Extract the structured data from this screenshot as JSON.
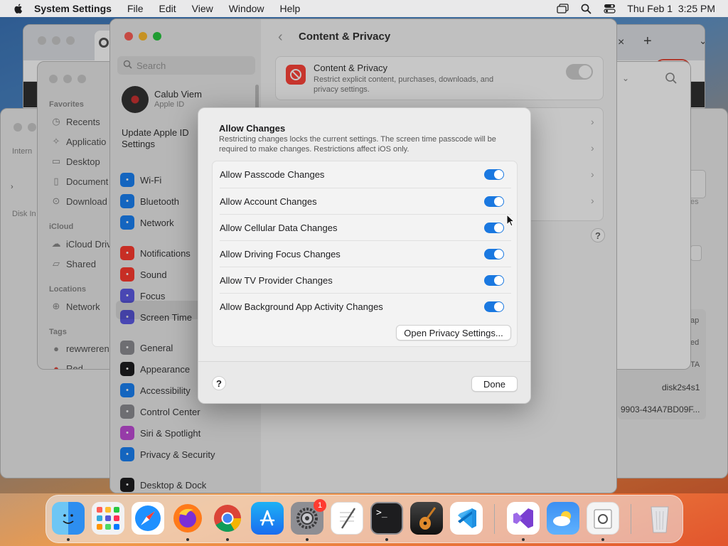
{
  "menubar": {
    "app": "System Settings",
    "menus": [
      "File",
      "Edit",
      "View",
      "Window",
      "Help"
    ],
    "clock": "Thu Feb 1  3:25 PM"
  },
  "finder": {
    "favorites_header": "Favorites",
    "favorites": [
      "Recents",
      "Applicatio",
      "Desktop",
      "Document",
      "Download"
    ],
    "icloud_header": "iCloud",
    "icloud": [
      "iCloud Driv",
      "Shared"
    ],
    "locations_header": "Locations",
    "locations": [
      "Network"
    ],
    "tags_header": "Tags",
    "tags": [
      "rewwreren",
      "Red"
    ]
  },
  "disk_utility": {
    "side_labels": [
      "Intern",
      "Disk In"
    ],
    "right_values": [
      "ap",
      "ed",
      "TA",
      "disk2s4s1",
      "9903-434A7BD09F..."
    ],
    "hint": "es"
  },
  "settings": {
    "search_placeholder": "Search",
    "user_name": "Calub Viem",
    "user_sub": "Apple ID",
    "update_label": "Update Apple ID Settings",
    "sidebar": [
      {
        "label": "Wi-Fi",
        "icon": "wifi-icon",
        "color": "#1a82f5"
      },
      {
        "label": "Bluetooth",
        "icon": "bluetooth-icon",
        "color": "#1a82f5"
      },
      {
        "label": "Network",
        "icon": "globe-icon",
        "color": "#1a82f5"
      },
      {
        "label": "Notifications",
        "icon": "bell-icon",
        "color": "#ff3b30"
      },
      {
        "label": "Sound",
        "icon": "speaker-icon",
        "color": "#ff3b30"
      },
      {
        "label": "Focus",
        "icon": "moon-icon",
        "color": "#5e5ce6"
      },
      {
        "label": "Screen Time",
        "icon": "hourglass-icon",
        "color": "#5e5ce6"
      },
      {
        "label": "General",
        "icon": "gear-icon",
        "color": "#8e8e93"
      },
      {
        "label": "Appearance",
        "icon": "appearance-icon",
        "color": "#1d1d1f"
      },
      {
        "label": "Accessibility",
        "icon": "accessibility-icon",
        "color": "#1a82f5"
      },
      {
        "label": "Control Center",
        "icon": "control-center-icon",
        "color": "#8e8e93"
      },
      {
        "label": "Siri & Spotlight",
        "icon": "siri-icon",
        "color": "#c04cd8"
      },
      {
        "label": "Privacy & Security",
        "icon": "hand-icon",
        "color": "#1a82f5"
      },
      {
        "label": "Desktop & Dock",
        "icon": "dock-icon",
        "color": "#1d1d1f"
      }
    ],
    "page_title": "Content & Privacy",
    "cp_title": "Content & Privacy",
    "cp_desc": "Restrict explicit content, purchases, downloads, and privacy settings."
  },
  "dialog": {
    "title": "Allow Changes",
    "description": "Restricting changes locks the current settings. The screen time passcode will be required to make changes. Restrictions affect iOS only.",
    "rows": [
      {
        "label": "Allow Passcode Changes",
        "on": true
      },
      {
        "label": "Allow Account Changes",
        "on": true
      },
      {
        "label": "Allow Cellular Data Changes",
        "on": true
      },
      {
        "label": "Allow Driving Focus Changes",
        "on": true
      },
      {
        "label": "Allow TV Provider Changes",
        "on": true
      },
      {
        "label": "Allow Background App Activity Changes",
        "on": true
      }
    ],
    "privacy_button": "Open Privacy Settings...",
    "help": "?",
    "done": "Done"
  },
  "dock": {
    "apps": [
      "finder-icon",
      "launchpad-icon",
      "safari-icon",
      "firefox-icon",
      "chrome-icon",
      "app-store-icon",
      "system-settings-icon",
      "textedit-icon",
      "terminal-icon",
      "garageband-icon",
      "vscode-icon",
      "visual-studio-icon",
      "weather-icon",
      "preview-icon",
      "trash-icon"
    ],
    "settings_badge": "1"
  },
  "colors": {
    "accent": "#1a78e0",
    "badge": "#ff3b30"
  }
}
